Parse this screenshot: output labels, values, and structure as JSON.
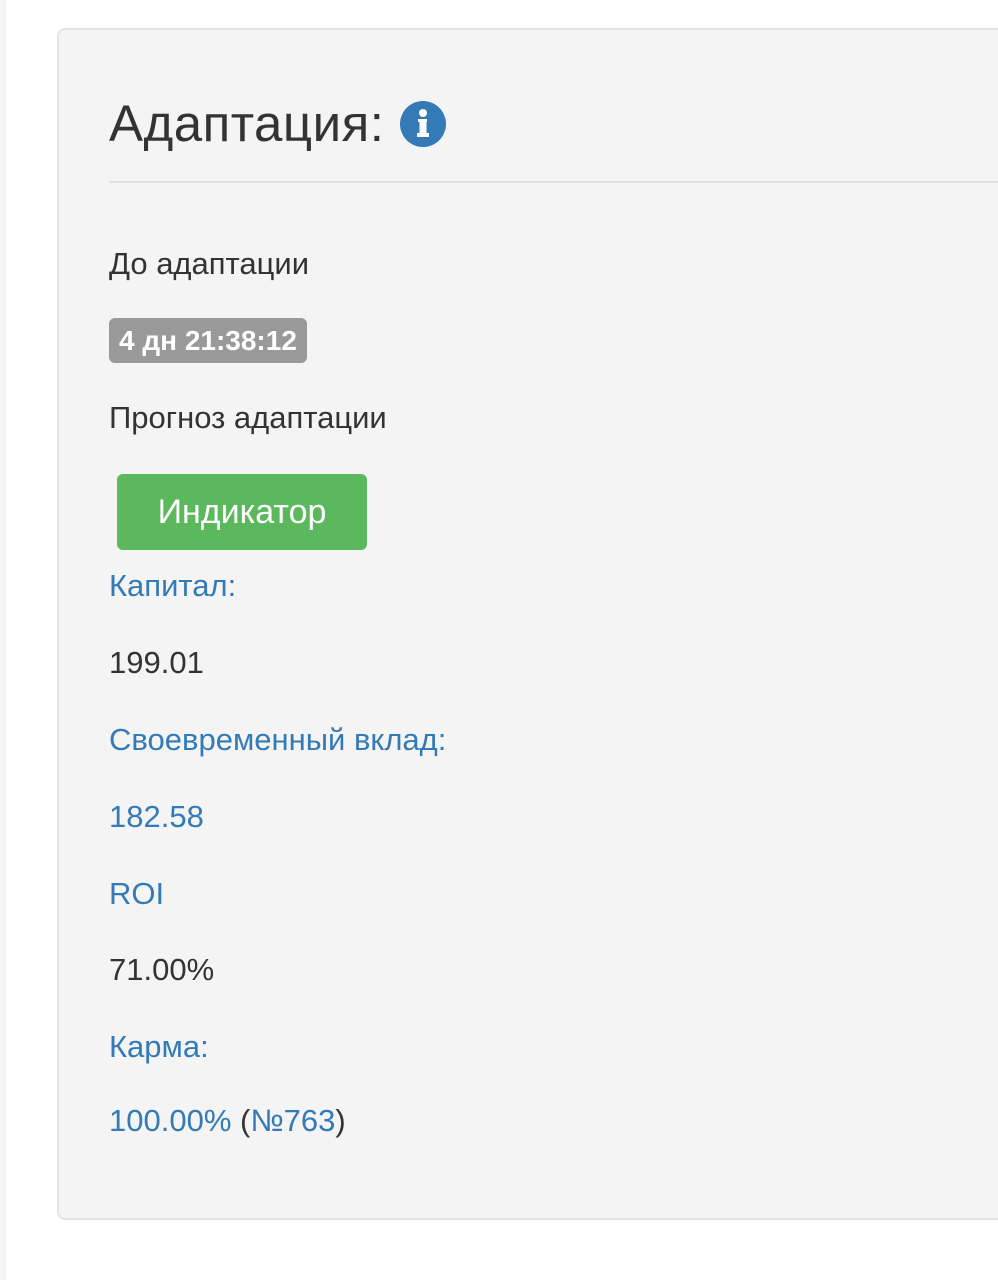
{
  "header": {
    "title": "Адаптация:",
    "info_icon": "info-circle-icon"
  },
  "before": {
    "label": "До адаптации",
    "timer": "4 дн 21:38:12"
  },
  "forecast": {
    "label": "Прогноз адаптации",
    "button_label": "Индикатор"
  },
  "capital": {
    "label": "Капитал:",
    "value": "199.01"
  },
  "deposit": {
    "label": "Своевременный вклад:",
    "value": "182.58"
  },
  "roi": {
    "label": "ROI",
    "value": "71.00%"
  },
  "karma": {
    "label": "Карма:",
    "value": "100.00%",
    "open_paren": " (",
    "rank": "№763",
    "close_paren": ")"
  },
  "colors": {
    "link_blue": "#337ab7",
    "button_green": "#5cb85c",
    "badge_gray": "#999999",
    "panel_bg": "#f4f4f4"
  }
}
